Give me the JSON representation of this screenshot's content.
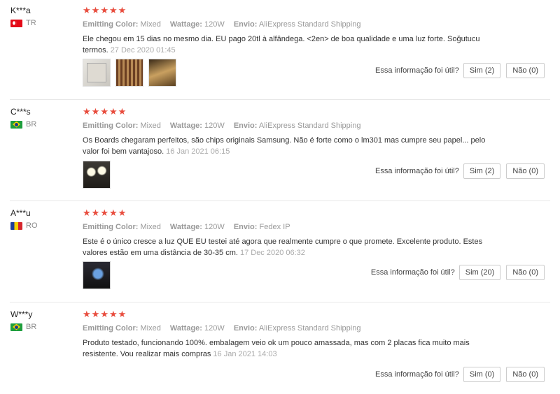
{
  "labels": {
    "color": "Emitting Color:",
    "wattage": "Wattage:",
    "shipping": "Envio:",
    "helpful": "Essa informação foi útil?"
  },
  "reviews": [
    {
      "user": "K***a",
      "country": "TR",
      "flag": "tr",
      "stars": 5,
      "color": "Mixed",
      "wattage": "120W",
      "shipping": "AliExpress Standard Shipping",
      "text": "Ele chegou em 15 dias no mesmo dia. EU pago 20tl à alfândega. <2en> de boa qualidade e uma luz forte. Soğutucu termos.",
      "date": "27 Dec 2020 01:45",
      "photos": [
        "panel-photo",
        "board-photo",
        "shelf-photo"
      ],
      "yes": "Sim (2)",
      "no": "Não (0)"
    },
    {
      "user": "C***s",
      "country": "BR",
      "flag": "br",
      "stars": 5,
      "color": "Mixed",
      "wattage": "120W",
      "shipping": "AliExpress Standard Shipping",
      "text": "Os Boards chegaram perfeitos, são chips originais Samsung. Não é forte como o lm301 mas cumpre seu papel... pelo valor foi bem vantajoso.",
      "date": "16 Jan 2021 06:15",
      "photos": [
        "lamps-photo"
      ],
      "yes": "Sim (2)",
      "no": "Não (0)"
    },
    {
      "user": "A***u",
      "country": "RO",
      "flag": "ro",
      "stars": 5,
      "color": "Mixed",
      "wattage": "120W",
      "shipping": "Fedex IP",
      "text": "Este é o único cresce a luz QUE EU testei até agora que realmente cumpre o que promete. Excelente produto. Estes valores estão em uma distância de 30-35 cm.",
      "date": "17 Dec 2020 06:32",
      "photos": [
        "phone-photo"
      ],
      "yes": "Sim (20)",
      "no": "Não (0)"
    },
    {
      "user": "W***y",
      "country": "BR",
      "flag": "br",
      "stars": 5,
      "color": "Mixed",
      "wattage": "120W",
      "shipping": "AliExpress Standard Shipping",
      "text": "Produto testado, funcionando 100%. embalagem veio ok um pouco amassada, mas com 2 placas fica muito mais resistente. Vou realizar mais compras",
      "date": "16 Jan 2021 14:03",
      "photos": [],
      "yes": "Sim (0)",
      "no": "Não (0)"
    }
  ]
}
